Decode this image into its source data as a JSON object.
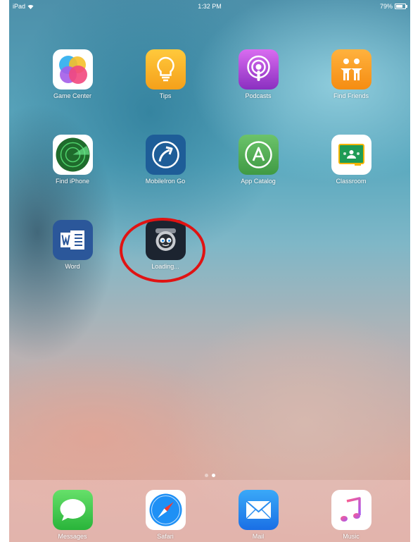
{
  "status_bar": {
    "device": "iPad",
    "time": "1:32 PM",
    "battery_percent": "79%",
    "battery_level": 0.79
  },
  "home_apps": [
    {
      "label": "Game Center",
      "icon": "game-center-icon"
    },
    {
      "label": "Tips",
      "icon": "lightbulb-icon"
    },
    {
      "label": "Podcasts",
      "icon": "podcast-icon"
    },
    {
      "label": "Find Friends",
      "icon": "friends-icon"
    },
    {
      "label": "Find iPhone",
      "icon": "radar-icon"
    },
    {
      "label": "MobileIron Go",
      "icon": "mobileiron-arrow-icon"
    },
    {
      "label": "App Catalog",
      "icon": "app-store-icon"
    },
    {
      "label": "Classroom",
      "icon": "classroom-board-icon"
    },
    {
      "label": "Word",
      "icon": "word-icon"
    },
    {
      "label": "Loading...",
      "icon": "webcam-icon"
    }
  ],
  "dock_apps": [
    {
      "label": "Messages",
      "icon": "speech-bubble-icon"
    },
    {
      "label": "Safari",
      "icon": "compass-icon"
    },
    {
      "label": "Mail",
      "icon": "envelope-icon"
    },
    {
      "label": "Music",
      "icon": "music-note-icon"
    }
  ],
  "page_indicator": {
    "pages": 2,
    "current": 2
  },
  "colors": {
    "highlight_circle": "#e01313"
  }
}
